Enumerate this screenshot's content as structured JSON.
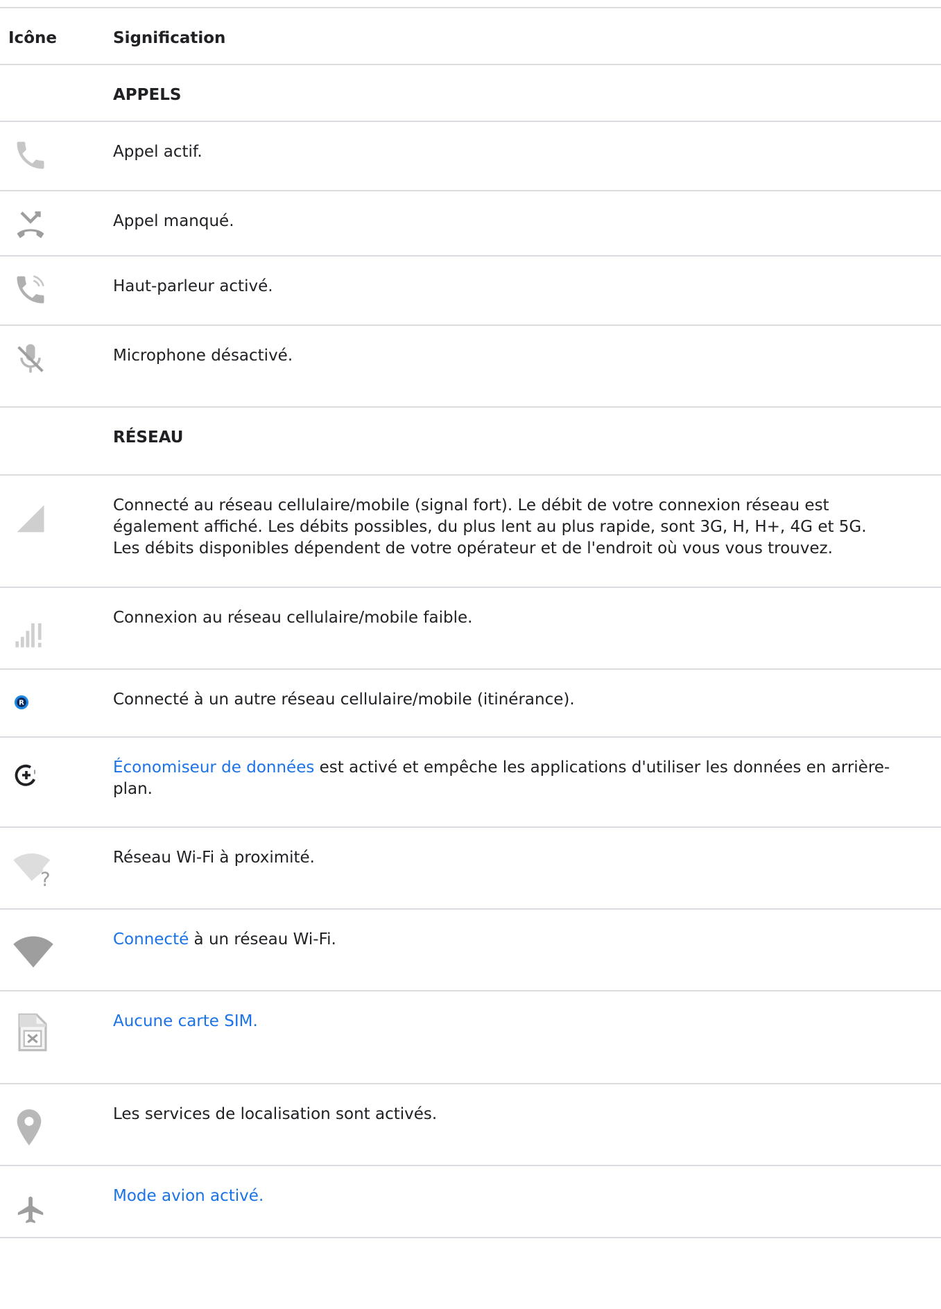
{
  "header": {
    "icon_col": "Icône",
    "meaning_col": "Signification"
  },
  "sections": {
    "calls": "APPELS",
    "network": "RÉSEAU"
  },
  "rows": {
    "active_call": "Appel actif.",
    "missed_call": "Appel manqué.",
    "speaker": "Haut-parleur activé.",
    "mic_off": "Microphone désactivé.",
    "signal_strong": "Connecté au réseau cellulaire/mobile (signal fort). Le débit de votre connexion réseau est également affiché. Les débits possibles, du plus lent au plus rapide, sont 3G, H, H+, 4G et 5G. Les débits disponibles dépendent de votre opérateur et de l'endroit où vous vous trouvez.",
    "signal_weak": "Connexion au réseau cellulaire/mobile faible.",
    "roaming": "Connecté à un autre réseau cellulaire/mobile (itinérance).",
    "data_saver_link": "Économiseur de données",
    "data_saver_rest": " est activé et empêche les applications d'utiliser les données en arrière-plan.",
    "wifi_nearby": "Réseau Wi-Fi à proximité.",
    "wifi_connected_link": "Connecté",
    "wifi_connected_rest": " à un réseau Wi-Fi.",
    "no_sim_link": "Aucune carte SIM.",
    "location": "Les services de localisation sont activés.",
    "airplane_link": "Mode avion activé."
  },
  "icons": {
    "phone": "phone-icon",
    "missed": "missed-call-icon",
    "speaker": "speakerphone-icon",
    "mic_off": "mic-off-icon",
    "signal": "signal-strong-icon",
    "weak": "signal-weak-icon",
    "roaming": "roaming-icon",
    "datasaver": "data-saver-icon",
    "wifi_q": "wifi-question-icon",
    "wifi": "wifi-icon",
    "sim": "no-sim-icon",
    "location": "location-pin-icon",
    "airplane": "airplane-icon"
  },
  "colors": {
    "link": "#1a73e8",
    "icon_grey": "#9e9e9e",
    "divider": "#dadce0",
    "roaming_blue": "#1e88e5"
  }
}
